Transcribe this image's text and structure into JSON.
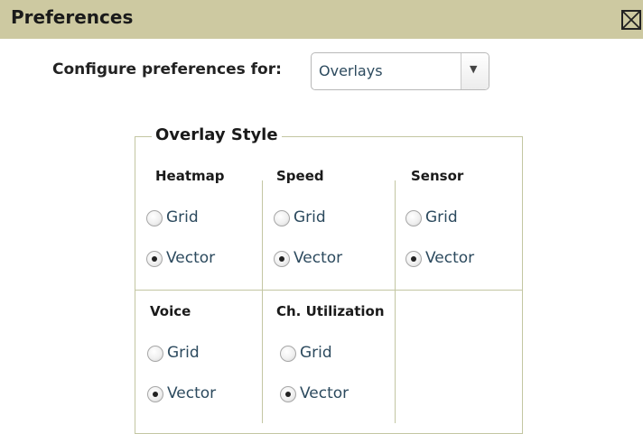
{
  "window": {
    "title": "Preferences",
    "close_icon": "close-box-icon"
  },
  "config": {
    "label": "Configure preferences for:",
    "selected": "Overlays",
    "arrow": "▼"
  },
  "overlay_style": {
    "legend": "Overlay Style",
    "option_labels": {
      "grid": "Grid",
      "vector": "Vector"
    },
    "groups": [
      {
        "name": "Heatmap",
        "selected": "Vector"
      },
      {
        "name": "Speed",
        "selected": "Vector"
      },
      {
        "name": "Sensor",
        "selected": "Vector"
      },
      {
        "name": "Voice",
        "selected": "Vector"
      },
      {
        "name": "Ch. Utilization",
        "selected": "Vector"
      }
    ]
  },
  "colors": {
    "titlebar": "#cdc9a1",
    "border": "#c3c6a2",
    "link_text": "#2c4a5e"
  }
}
